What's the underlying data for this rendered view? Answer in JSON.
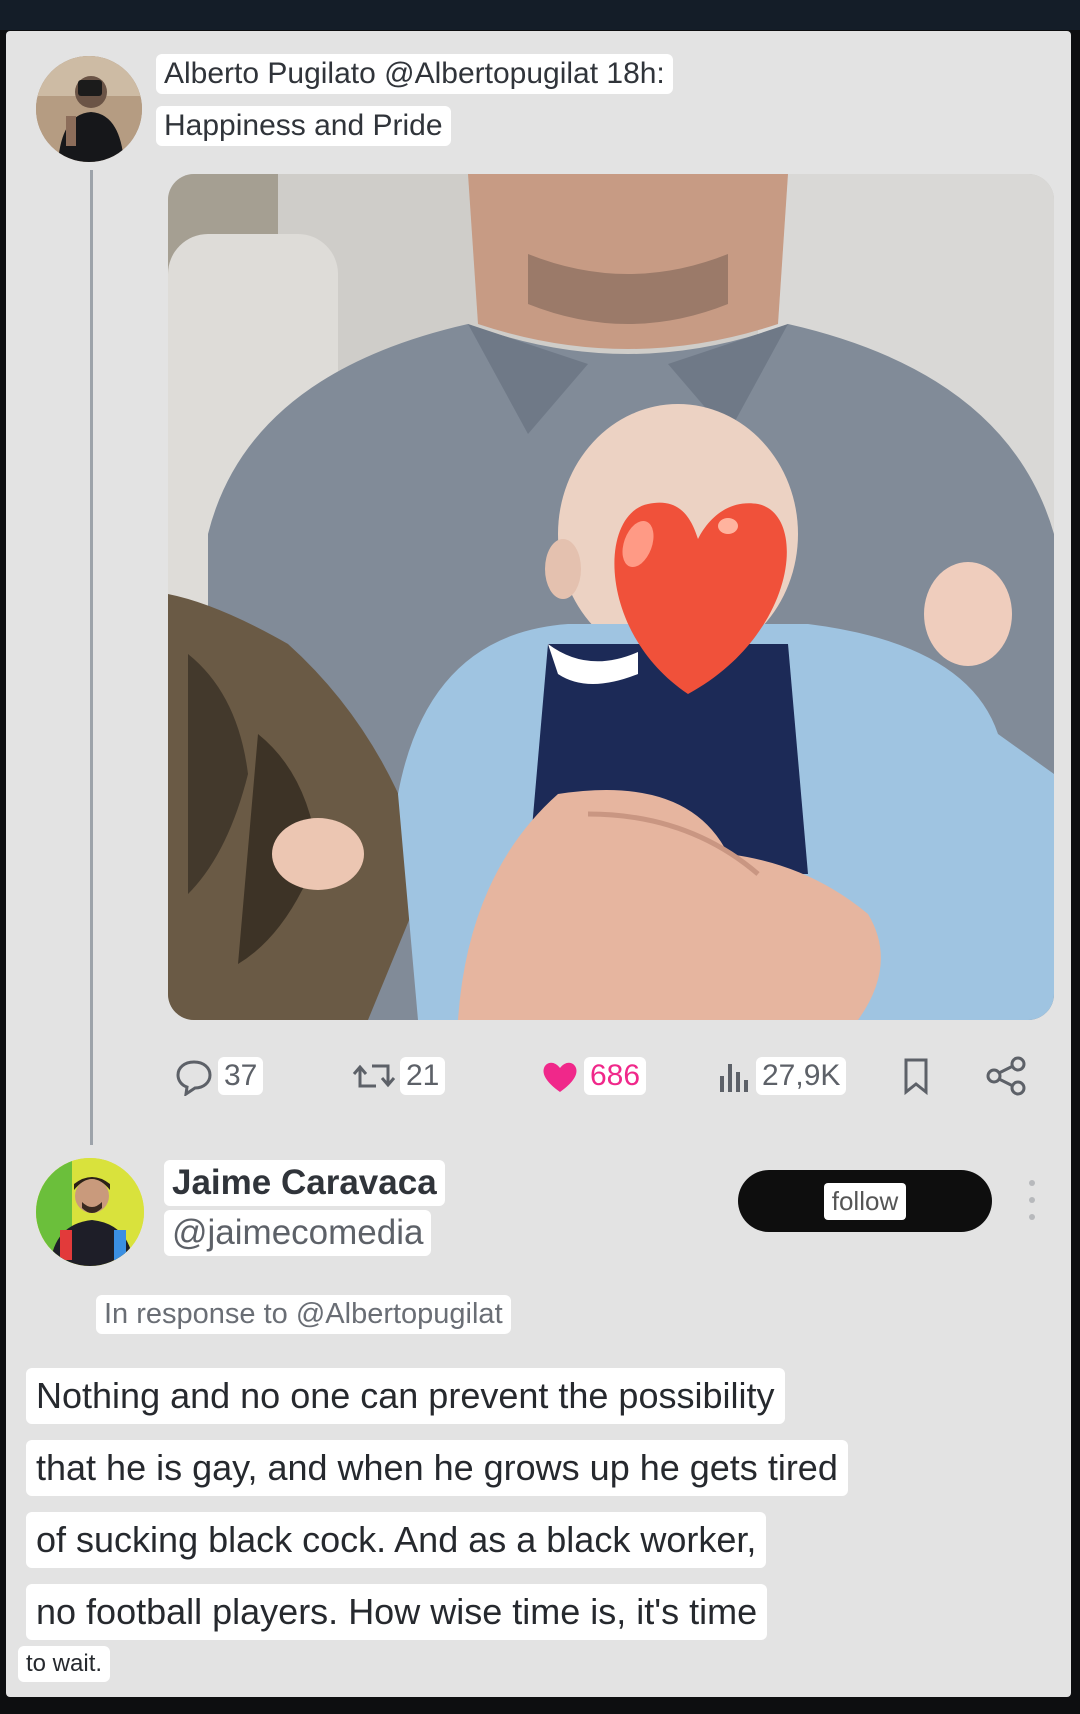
{
  "post": {
    "meta": "Alberto Pugilato @Albertopugilat 18h:",
    "text": "Happiness and Pride",
    "actions": {
      "replies": "37",
      "reposts": "21",
      "likes": "686",
      "views": "27,9K"
    }
  },
  "reply": {
    "name": "Jaime Caravaca",
    "handle": "@jaimecomedia",
    "follow_label": "follow",
    "in_response": "In response to @Albertopugilat",
    "lines": [
      "Nothing and no one can prevent the possibility",
      "that he is gay, and when he grows up he gets tired",
      "of sucking black cock. And as a black worker,",
      "no football players. How wise time is, it's time"
    ],
    "last_line": "to wait."
  },
  "icons": {
    "reply": "comment-icon",
    "repost": "repost-icon",
    "like": "heart-icon",
    "views": "views-icon",
    "bookmark": "bookmark-icon",
    "share": "share-icon",
    "more": "more-vertical-icon",
    "censor": "heart-emoji-icon"
  },
  "colors": {
    "like": "#f0288a",
    "background": "#e3e3e3",
    "follow_button": "#0e0e0e"
  }
}
